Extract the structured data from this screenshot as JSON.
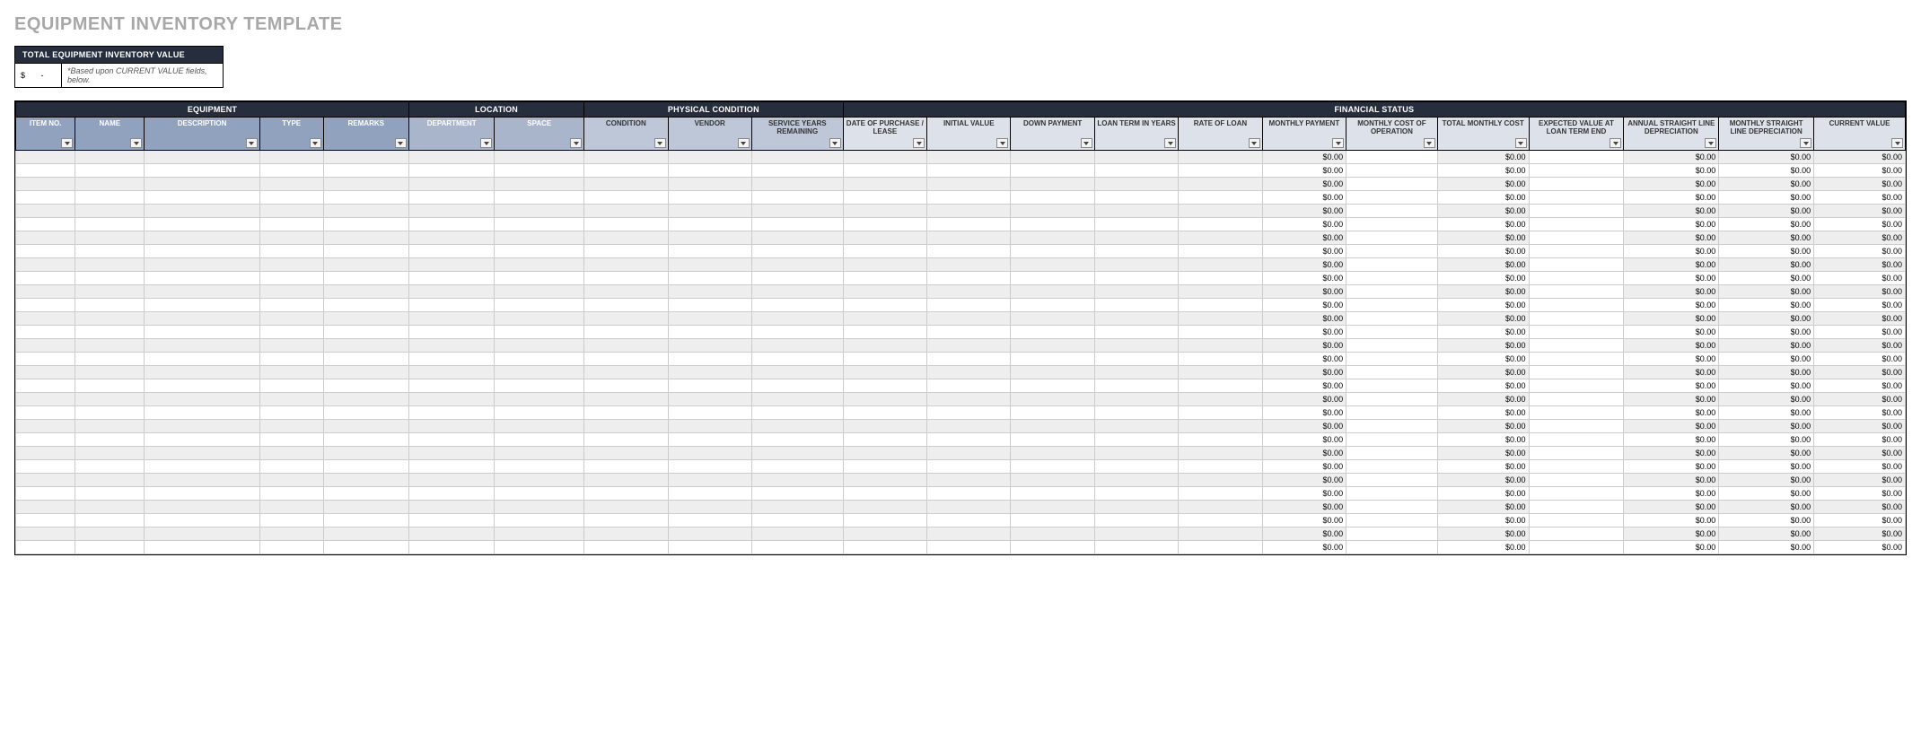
{
  "title": "EQUIPMENT INVENTORY TEMPLATE",
  "summary": {
    "header": "TOTAL EQUIPMENT INVENTORY VALUE",
    "currency_label": "$",
    "value_label": "-",
    "note": "*Based upon CURRENT VALUE fields, below."
  },
  "groups": {
    "equipment": "EQUIPMENT",
    "location": "LOCATION",
    "physical_condition": "PHYSICAL CONDITION",
    "financial_status": "FINANCIAL STATUS"
  },
  "columns": {
    "item_no": "ITEM NO.",
    "name": "NAME",
    "description": "DESCRIPTION",
    "type": "TYPE",
    "remarks": "REMARKS",
    "department": "DEPARTMENT",
    "space": "SPACE",
    "condition": "CONDITION",
    "vendor": "VENDOR",
    "service_years": "SERVICE YEARS REMAINING",
    "date_purchase": "DATE OF PURCHASE / LEASE",
    "initial_value": "INITIAL VALUE",
    "down_payment": "DOWN PAYMENT",
    "loan_term": "LOAN TERM IN YEARS",
    "rate_loan": "RATE OF LOAN",
    "monthly_payment": "MONTHLY PAYMENT",
    "monthly_cost_op": "MONTHLY COST OF OPERATION",
    "total_monthly_cost": "TOTAL MONTHLY COST",
    "expected_value": "EXPECTED VALUE AT LOAN TERM END",
    "annual_sl_dep": "ANNUAL STRAIGHT LINE DEPRECIATION",
    "monthly_sl_dep": "MONTHLY STRAIGHT LINE DEPRECIATION",
    "current_value": "CURRENT VALUE"
  },
  "default_money": "$0.00",
  "row_count": 30
}
